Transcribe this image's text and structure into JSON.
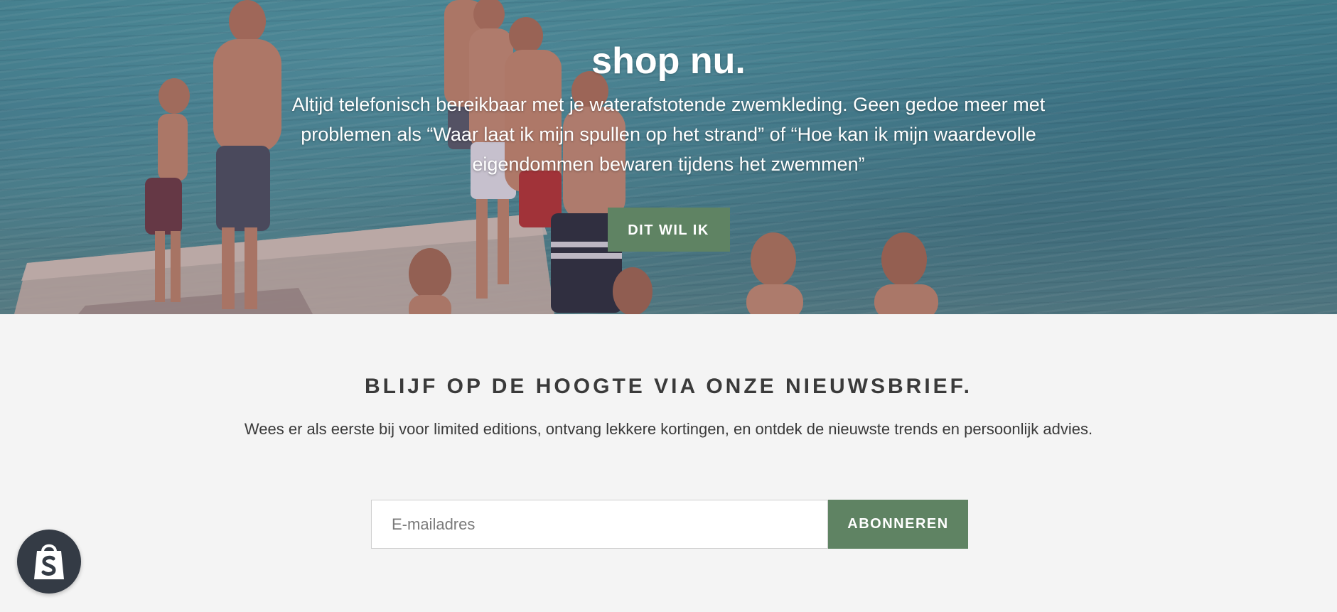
{
  "hero": {
    "title": "shop nu.",
    "text": "Altijd telefonisch bereikbaar met je waterafstotende zwemkleding. Geen gedoe meer met problemen als “Waar laat ik mijn spullen op het strand” of “Hoe kan ik mijn waardevolle eigendommen bewaren tijdens het zwemmen”",
    "button_label": "DIT WIL IK"
  },
  "newsletter": {
    "title": "BLIJF OP DE HOOGTE VIA ONZE NIEUWSBRIEF.",
    "text": "Wees er als eerste bij voor limited editions, ontvang lekkere kortingen, en ontdek de nieuwste trends en persoonlijk advies.",
    "email_placeholder": "E-mailadres",
    "email_value": "",
    "subscribe_label": "ABONNEREN"
  },
  "badge": {
    "icon": "shopify-bag-icon"
  },
  "colors": {
    "accent": "#5f8363",
    "background": "#f4f4f4",
    "text": "#3a3a3a",
    "badge": "#343b45"
  }
}
